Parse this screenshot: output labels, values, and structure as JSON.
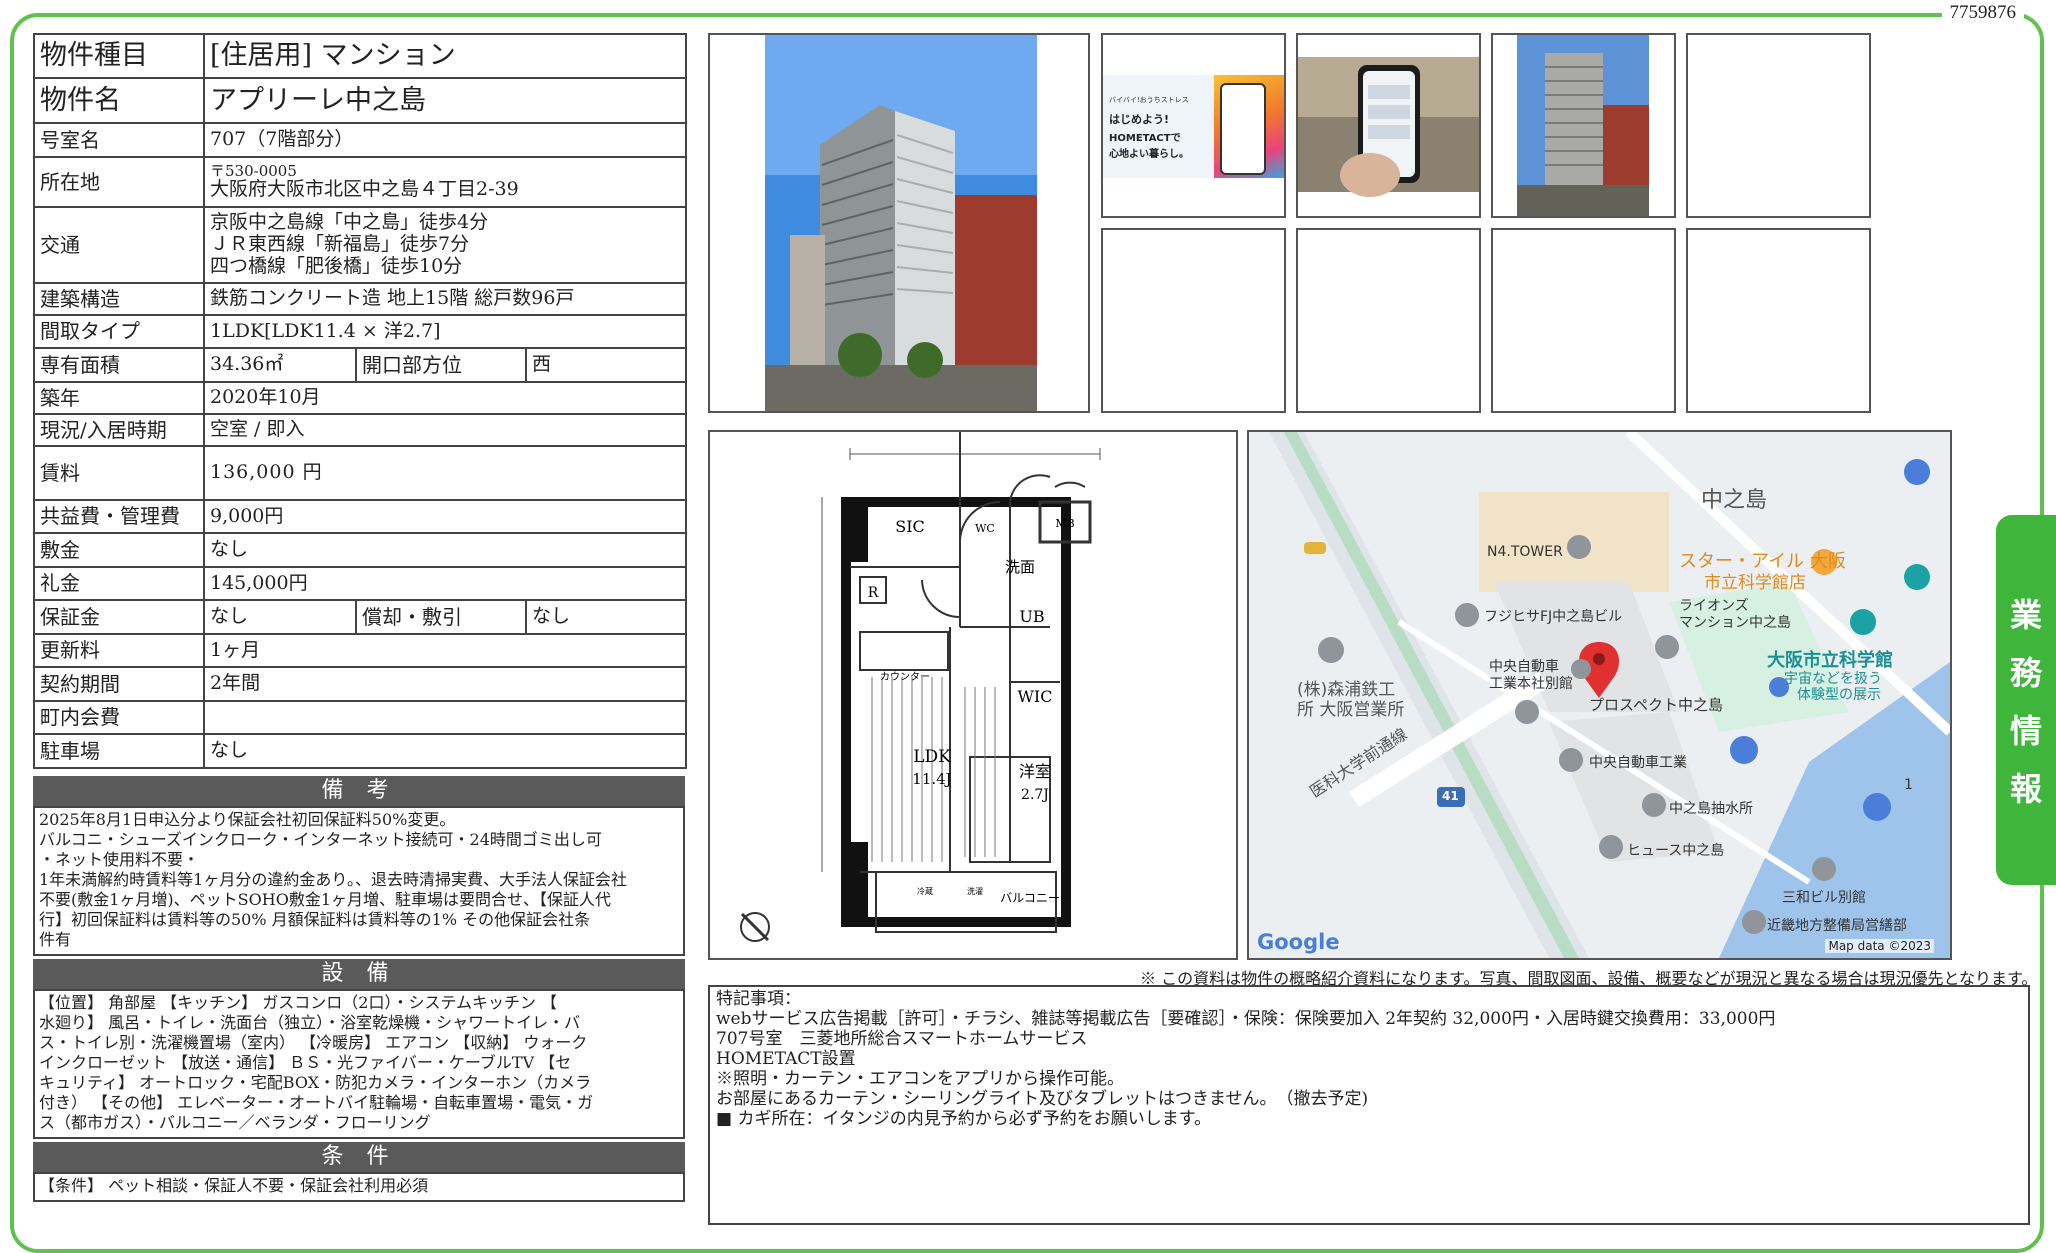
{
  "doc_id": "7759876",
  "spec": {
    "type_label": "物件種目",
    "type_value": "[住居用] マンション",
    "name_label": "物件名",
    "name_value": "アプリーレ中之島",
    "room_label": "号室名",
    "room_value": "707（7階部分）",
    "address_label": "所在地",
    "postal": "〒530-0005",
    "address": "大阪府大阪市北区中之島４丁目2-39",
    "transit_label": "交通",
    "transit": [
      "京阪中之島線「中之島」徒歩4分",
      "ＪＲ東西線「新福島」徒歩7分",
      "四つ橋線「肥後橋」徒歩10分"
    ],
    "structure_label": "建築構造",
    "structure_value": "鉄筋コンクリート造 地上15階 総戸数96戸",
    "layout_label": "間取タイプ",
    "layout_value": "1LDK[LDK11.4 × 洋2.7]",
    "area_label": "専有面積",
    "area_value": "34.36㎡",
    "direction_label": "開口部方位",
    "direction_value": "西",
    "built_label": "築年",
    "built_value": "2020年10月",
    "status_label": "現況/入居時期",
    "status_value": "空室 / 即入",
    "rent_label": "賃料",
    "rent_value": "136,000 円",
    "common_label": "共益費・管理費",
    "common_value": "9,000円",
    "deposit_label": "敷金",
    "deposit_value": "なし",
    "keymoney_label": "礼金",
    "keymoney_value": "145,000円",
    "guarantee_label": "保証金",
    "guarantee_value": "なし",
    "amort_label": "償却・敷引",
    "amort_value": "なし",
    "renewal_label": "更新料",
    "renewal_value": "1ヶ月",
    "contract_label": "契約期間",
    "contract_value": "2年間",
    "town_label": "町内会費",
    "town_value": "",
    "parking_label": "駐車場",
    "parking_value": "なし"
  },
  "remarks": {
    "title": "備 考",
    "lines": [
      "2025年8月1日申込分より保証会社初回保証料50%変更。",
      "バルコニ・シューズインクローク・インターネット接続可・24時間ゴミ出し可",
      "・ネット使用料不要・",
      "1年未満解約時賃料等1ヶ月分の違約金あり。、退去時清掃実費、大手法人保証会社",
      "不要(敷金1ヶ月増)、ペットSOHO敷金1ヶ月増、駐車場は要問合せ、【保証人代",
      "行】初回保証料は賃料等の50% 月額保証料は賃料等の1% その他保証会社条",
      "件有"
    ]
  },
  "equipment": {
    "title": "設 備",
    "lines": [
      "【位置】 角部屋 【キッチン】 ガスコンロ（2口）・システムキッチン 【",
      "水廻り】 風呂・トイレ・洗面台（独立）・浴室乾燥機・シャワートイレ・バ",
      "ス・トイレ別・洗濯機置場（室内） 【冷暖房】 エアコン 【収納】 ウォーク",
      "インクローゼット 【放送・通信】 ＢＳ・光ファイバー・ケーブルTV 【セ",
      "キュリティ】 オートロック・宅配BOX・防犯カメラ・インターホン（カメラ",
      "付き） 【その他】 エレベーター・オートバイ駐輪場・自転車置場・電気・ガ",
      "ス（都市ガス）・バルコニー／ベランダ・フローリング"
    ]
  },
  "conditions": {
    "title": "条 件",
    "lines": [
      "【条件】 ペット相談・保証人不要・保証会社利用必須"
    ]
  },
  "thumb1_text": [
    "バイバイ!おうちストレス",
    "はじめよう!",
    "HOMETACTで",
    "心地よい暮らし。"
  ],
  "floorplan": {
    "labels": [
      "SIC",
      "WC",
      "MB",
      "洗面",
      "UB",
      "WIC",
      "R",
      "カウンター",
      "LDK",
      "11.4J",
      "洋室",
      "2.7J",
      "バルコニー",
      "冷蔵",
      "洗濯"
    ]
  },
  "map": {
    "area": "中之島",
    "labels": [
      "N4.TOWER",
      "スター・アイル 大阪",
      "市立科学館店",
      "ライオンズ",
      "マンション中之島",
      "フジヒサFJ中之島ビル",
      "中央自動車",
      "工業本社別館",
      "(株)森浦鉄工",
      "所 大阪営業所",
      "大阪市立科学館",
      "宇宙などを扱う",
      "体験型の展示",
      "プロスペクト中之島",
      "中央自動車工業",
      "中之島抽水所",
      "ヒュース中之島",
      "医科大学前通線",
      "三和ビル別館",
      "近畿地方整備局営繕部",
      "41",
      "1"
    ],
    "google": "Google",
    "mapdata": "Map data ©2023"
  },
  "side_tab": [
    "業",
    "務",
    "情",
    "報"
  ],
  "disclaimer": "※ この資料は物件の概略紹介資料になります。写真、間取図面、設備、概要などが現況と異なる場合は現況優先となります。",
  "special": {
    "lines": [
      "特記事項：",
      "webサービス広告掲載［許可］・チラシ、雑誌等掲載広告［要確認］・保険：保険要加入 2年契約 32,000円・入居時鍵交換費用：33,000円",
      "707号室　三菱地所総合スマートホームサービス",
      "HOMETACT設置",
      "※照明・カーテン・エアコンをアプリから操作可能。",
      "お部屋にあるカーテン・シーリングライト及びタブレットはつきません。　（撤去予定)",
      "■ カギ所在：イタンジの内見予約から必ず予約をお願いします。"
    ]
  },
  "colors": {
    "accent_green": "#5fc24a",
    "tab_green": "#3fb53c",
    "section_gray": "#5a5a5a",
    "map_pin": "#e03030"
  }
}
